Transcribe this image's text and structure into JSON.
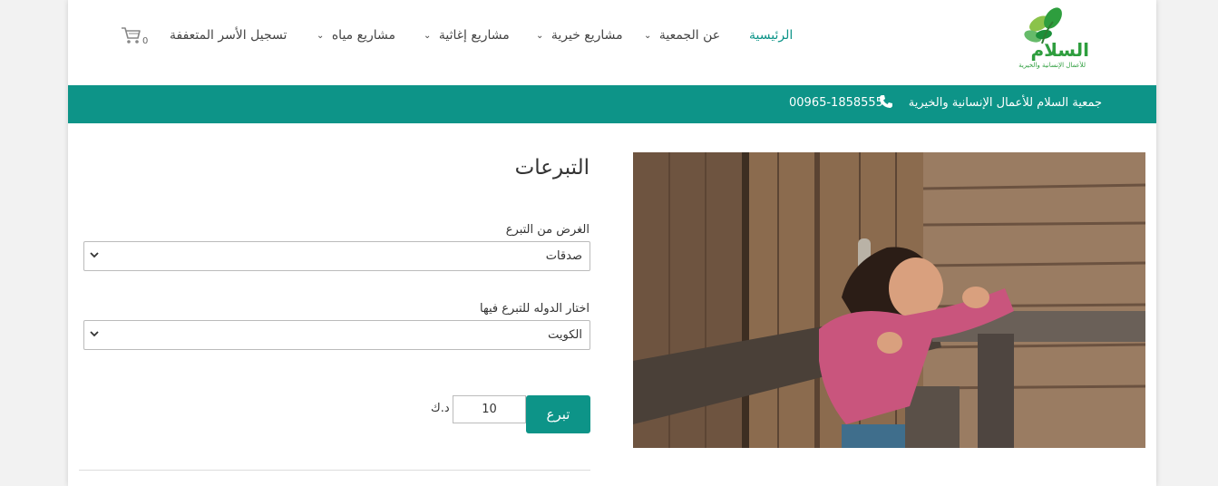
{
  "logo": {
    "text": "السلام",
    "subtext": "للأعمال الإنسانية والخيرية"
  },
  "nav": {
    "home": "الرئيسية",
    "about": "عن الجمعية",
    "charity": "مشاريع خيرية",
    "relief": "مشاريع إغاثية",
    "water": "مشاريع مياه",
    "register": "تسجيل الأسر المتعففة"
  },
  "cart": {
    "count": "0"
  },
  "topbar": {
    "org_name": "جمعية السلام للأعمال الإنسانية والخيرية",
    "phone": "00965-1858555"
  },
  "form": {
    "title": "التبرعات",
    "purpose_label": "الغرض من التبرع",
    "purpose_value": "صدقات",
    "country_label": "اختار الدوله للتبرع فيها",
    "country_value": "الكويت",
    "amount": "10",
    "currency": "د.ك",
    "donate_button": "تبرع"
  },
  "colors": {
    "accent": "#0d9488",
    "logo_green": "#2e9e3e"
  },
  "icons": [
    "cart-icon",
    "phone-icon",
    "chevron-down-icon"
  ]
}
